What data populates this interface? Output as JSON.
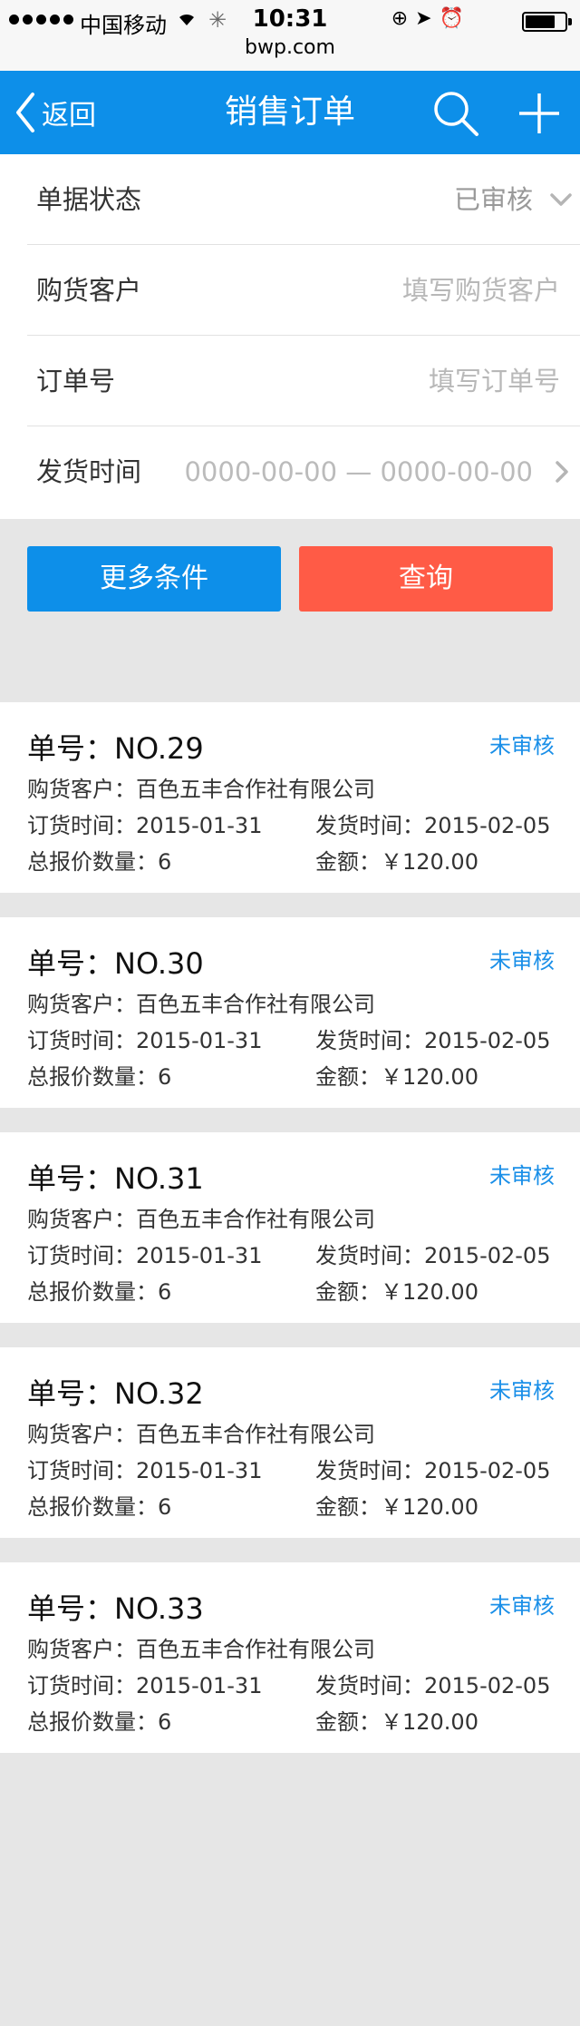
{
  "status_bar": {
    "carrier": "中国移动",
    "time": "10:31",
    "url": "bwp.com"
  },
  "nav": {
    "back_label": "返回",
    "title": "销售订单"
  },
  "filters": {
    "status": {
      "label": "单据状态",
      "value": "已审核"
    },
    "customer": {
      "label": "购货客户",
      "placeholder": "填写购货客户"
    },
    "order_no": {
      "label": "订单号",
      "placeholder": "填写订单号"
    },
    "ship_time": {
      "label": "发货时间",
      "range": "0000-00-00 — 0000-00-00"
    }
  },
  "buttons": {
    "more": "更多条件",
    "query": "查询"
  },
  "orders": [
    {
      "no": "单号：NO.29",
      "status": "未审核",
      "customer": "购货客户：百色五丰合作社有限公司",
      "order_time": "订货时间：2015-01-31",
      "ship_time": "发货时间：2015-02-05",
      "quantity": "总报价数量：6",
      "amount": "金额：￥120.00"
    },
    {
      "no": "单号：NO.30",
      "status": "未审核",
      "customer": "购货客户：百色五丰合作社有限公司",
      "order_time": "订货时间：2015-01-31",
      "ship_time": "发货时间：2015-02-05",
      "quantity": "总报价数量：6",
      "amount": "金额：￥120.00"
    },
    {
      "no": "单号：NO.31",
      "status": "未审核",
      "customer": "购货客户：百色五丰合作社有限公司",
      "order_time": "订货时间：2015-01-31",
      "ship_time": "发货时间：2015-02-05",
      "quantity": "总报价数量：6",
      "amount": "金额：￥120.00"
    },
    {
      "no": "单号：NO.32",
      "status": "未审核",
      "customer": "购货客户：百色五丰合作社有限公司",
      "order_time": "订货时间：2015-01-31",
      "ship_time": "发货时间：2015-02-05",
      "quantity": "总报价数量：6",
      "amount": "金额：￥120.00"
    },
    {
      "no": "单号：NO.33",
      "status": "未审核",
      "customer": "购货客户：百色五丰合作社有限公司",
      "order_time": "订货时间：2015-01-31",
      "ship_time": "发货时间：2015-02-05",
      "quantity": "总报价数量：6",
      "amount": "金额：￥120.00"
    }
  ]
}
